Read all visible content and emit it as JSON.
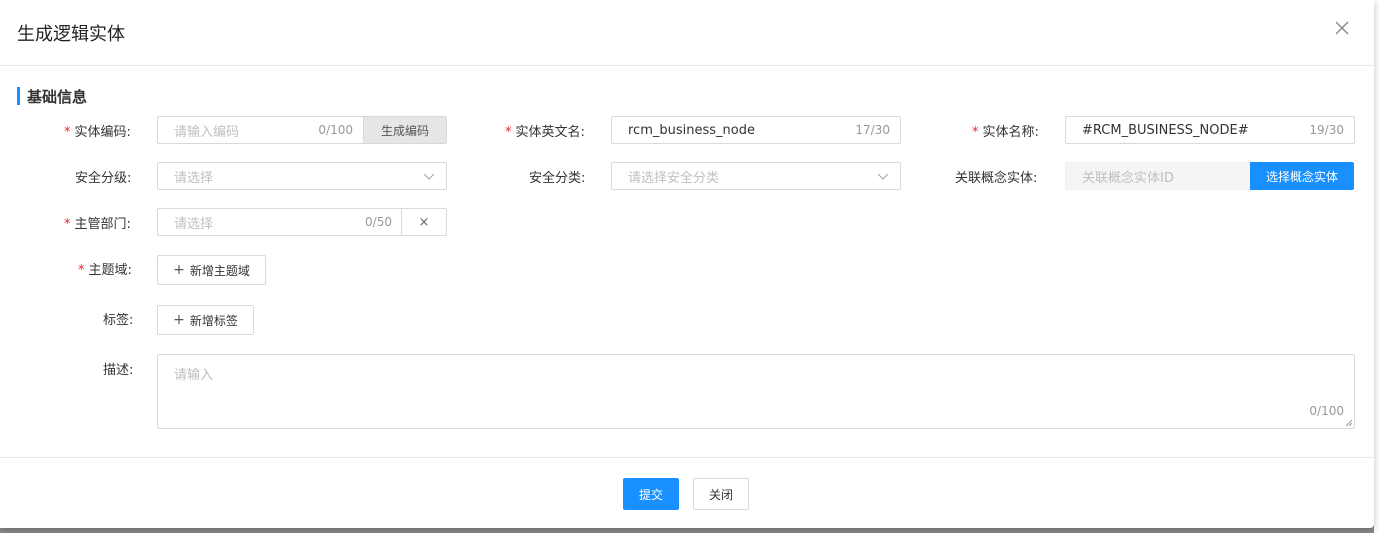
{
  "dialog": {
    "title": "生成逻辑实体",
    "close_icon": "close-icon"
  },
  "section": {
    "title": "基础信息"
  },
  "fields": {
    "entity_code": {
      "label": "实体编码:",
      "placeholder": "请输入编码",
      "count": "0/100",
      "action_label": "生成编码",
      "required": "*"
    },
    "entity_en_name": {
      "label": "实体英文名:",
      "value": "rcm_business_node",
      "count": "17/30",
      "required": "*"
    },
    "entity_name": {
      "label": "实体名称:",
      "value": "#RCM_BUSINESS_NODE#",
      "count": "19/30",
      "required": "*"
    },
    "security_level": {
      "label": "安全分级:",
      "placeholder": "请选择"
    },
    "security_category": {
      "label": "安全分类:",
      "placeholder": "请选择安全分类"
    },
    "concept_entity": {
      "label": "关联概念实体:",
      "placeholder": "关联概念实体ID",
      "action_label": "选择概念实体"
    },
    "department": {
      "label": "主管部门:",
      "placeholder": "请选择",
      "count": "0/50",
      "clear_label": "×",
      "required": "*"
    },
    "subject_domain": {
      "label": "主题域:",
      "add_label": "新增主题域",
      "plus": "+",
      "required": "*"
    },
    "tags": {
      "label": "标签:",
      "add_label": "新增标签",
      "plus": "+"
    },
    "description": {
      "label": "描述:",
      "placeholder": "请输入",
      "count": "0/100"
    }
  },
  "footer": {
    "submit_label": "提交",
    "close_label": "关闭"
  },
  "colors": {
    "primary": "#1890ff",
    "required": "#f5222d"
  }
}
